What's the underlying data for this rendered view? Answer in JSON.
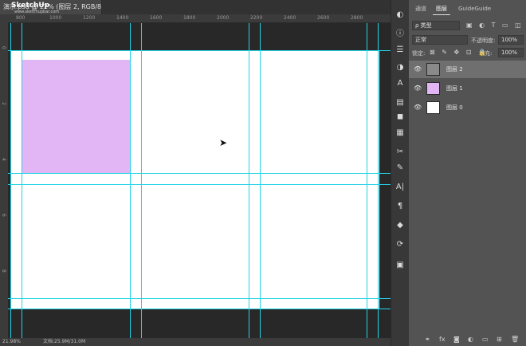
{
  "document": {
    "tab_title": "演示.psd @ 22% (图层 2, RGB/8)",
    "close_glyph": "×",
    "watermark": "SketchUp",
    "watermark_sub": "www.sketchupbar.com"
  },
  "ruler": {
    "h_ticks": [
      "800",
      "1000",
      "1200",
      "1400",
      "1600",
      "1800",
      "2000",
      "2200",
      "2400",
      "2600",
      "2800"
    ],
    "v_ticks": [
      "0",
      "2",
      "4",
      "6",
      "8"
    ]
  },
  "statusbar": {
    "zoom": "21.98%",
    "doc_size": "文档:25.9M/31.0M"
  },
  "tools": [
    "history-icon",
    "info-icon",
    "properties-icon",
    "adjustments-icon",
    "character-icon",
    "libraries-icon",
    "color-icon",
    "swatches-icon",
    "paths-icon",
    "brush-icon",
    "text-icon",
    "paragraph-icon",
    "3d-icon",
    "rotate-icon",
    "artboard-icon"
  ],
  "layers_panel": {
    "tabs": [
      "通道",
      "图层",
      "GuideGuide"
    ],
    "active_tab": "图层",
    "filter_label": "ρ 类型",
    "blend_mode": "正常",
    "opacity_label": "不透明度:",
    "opacity_value": "100%",
    "lock_label": "锁定:",
    "fill_label": "填充:",
    "fill_value": "100%",
    "layers": [
      {
        "name": "图层 2",
        "selected": true,
        "thumb_color": "#8a8a8a"
      },
      {
        "name": "图层 1",
        "selected": false,
        "thumb_color": "#e2b6f4"
      },
      {
        "name": "图层 0",
        "selected": false,
        "thumb_color": "#ffffff"
      }
    ]
  },
  "colors": {
    "guide": "#22d3e6",
    "pink_rect": "#e2b6f4",
    "workspace": "#282828"
  }
}
